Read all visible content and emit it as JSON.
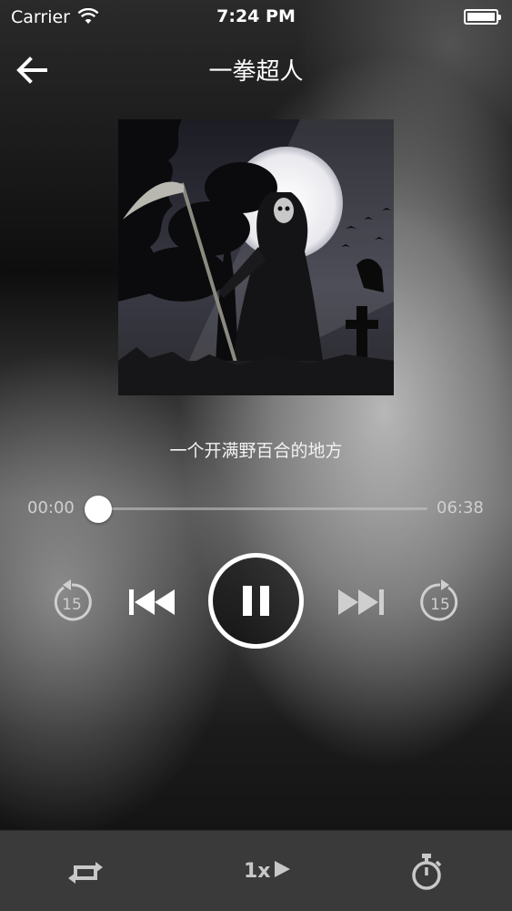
{
  "status_bar": {
    "carrier": "Carrier",
    "time": "7:24 PM"
  },
  "nav": {
    "back_icon": "arrow-left-icon",
    "title": "一拳超人"
  },
  "album": {
    "art_description_icon": "grim-reaper-album-art"
  },
  "track": {
    "subtitle": "一个开满野百合的地方"
  },
  "progress": {
    "elapsed": "00:00",
    "total": "06:38",
    "fraction": 0.0
  },
  "controls": {
    "rewind_seconds": "15",
    "forward_seconds": "15",
    "state": "playing"
  },
  "bottom_bar": {
    "speed_label": "1x",
    "repeat_icon": "repeat-icon",
    "timer_icon": "stopwatch-icon"
  },
  "colors": {
    "accent": "#ffffff",
    "control_dim": "#cfcfcf",
    "bottom_bar": "#3a3a3a"
  }
}
